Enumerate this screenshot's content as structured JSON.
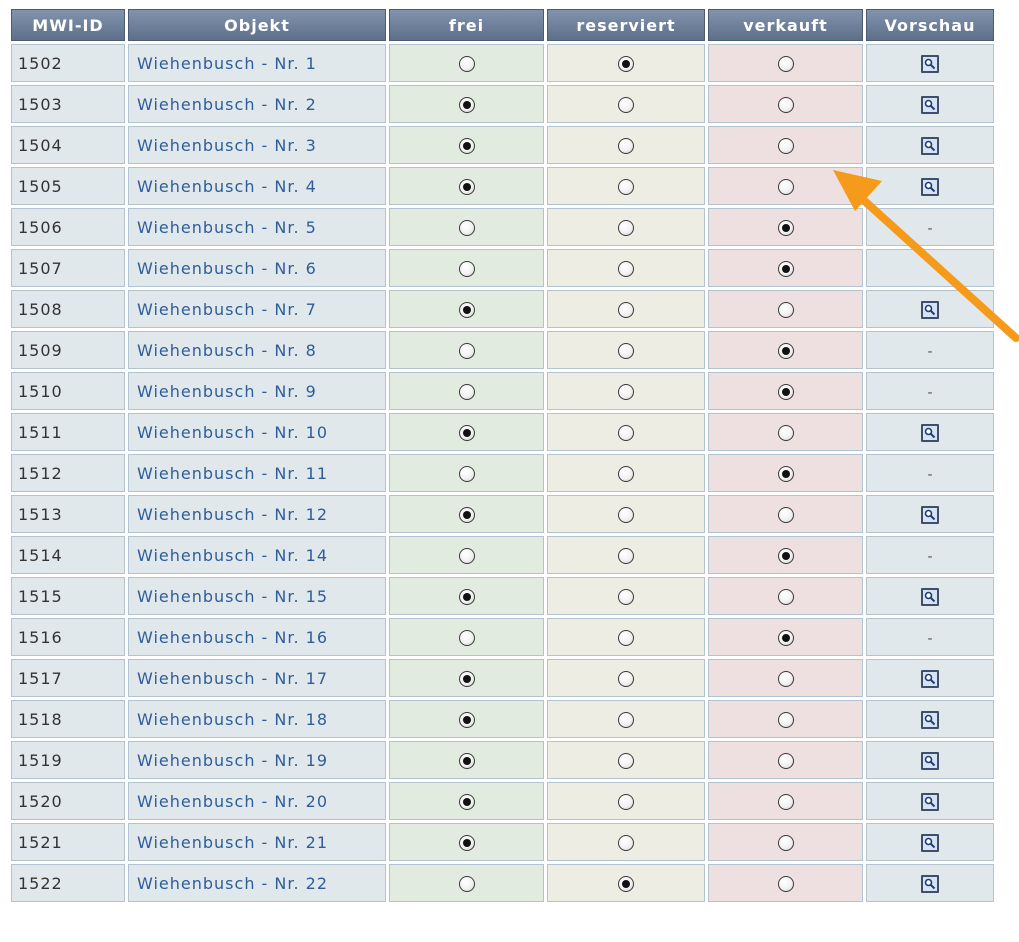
{
  "headers": {
    "id": "MWI-ID",
    "objekt": "Objekt",
    "frei": "frei",
    "reserviert": "reserviert",
    "verkauft": "verkauft",
    "vorschau": "Vorschau"
  },
  "preview_icon": "magnifier-icon",
  "no_preview_text": "-",
  "colors": {
    "header": "#6b7d97",
    "frei_bg": "#e1ebdf",
    "reserviert_bg": "#eeede3",
    "verkauft_bg": "#eedfe0",
    "link": "#2e5d99",
    "arrow": "#f59a1b"
  },
  "rows": [
    {
      "id": "1502",
      "objekt": "Wiehenbusch - Nr. 1",
      "status": "reserviert",
      "preview": true
    },
    {
      "id": "1503",
      "objekt": "Wiehenbusch - Nr. 2",
      "status": "frei",
      "preview": true
    },
    {
      "id": "1504",
      "objekt": "Wiehenbusch - Nr. 3",
      "status": "frei",
      "preview": true
    },
    {
      "id": "1505",
      "objekt": "Wiehenbusch - Nr. 4",
      "status": "frei",
      "preview": true
    },
    {
      "id": "1506",
      "objekt": "Wiehenbusch - Nr. 5",
      "status": "verkauft",
      "preview": false
    },
    {
      "id": "1507",
      "objekt": "Wiehenbusch - Nr. 6",
      "status": "verkauft",
      "preview": null
    },
    {
      "id": "1508",
      "objekt": "Wiehenbusch - Nr. 7",
      "status": "frei",
      "preview": true
    },
    {
      "id": "1509",
      "objekt": "Wiehenbusch - Nr. 8",
      "status": "verkauft",
      "preview": false
    },
    {
      "id": "1510",
      "objekt": "Wiehenbusch - Nr. 9",
      "status": "verkauft",
      "preview": false
    },
    {
      "id": "1511",
      "objekt": "Wiehenbusch - Nr. 10",
      "status": "frei",
      "preview": true
    },
    {
      "id": "1512",
      "objekt": "Wiehenbusch - Nr. 11",
      "status": "verkauft",
      "preview": false
    },
    {
      "id": "1513",
      "objekt": "Wiehenbusch - Nr. 12",
      "status": "frei",
      "preview": true
    },
    {
      "id": "1514",
      "objekt": "Wiehenbusch - Nr. 14",
      "status": "verkauft",
      "preview": false
    },
    {
      "id": "1515",
      "objekt": "Wiehenbusch - Nr. 15",
      "status": "frei",
      "preview": true
    },
    {
      "id": "1516",
      "objekt": "Wiehenbusch - Nr. 16",
      "status": "verkauft",
      "preview": false
    },
    {
      "id": "1517",
      "objekt": "Wiehenbusch - Nr. 17",
      "status": "frei",
      "preview": true
    },
    {
      "id": "1518",
      "objekt": "Wiehenbusch - Nr. 18",
      "status": "frei",
      "preview": true
    },
    {
      "id": "1519",
      "objekt": "Wiehenbusch - Nr. 19",
      "status": "frei",
      "preview": true
    },
    {
      "id": "1520",
      "objekt": "Wiehenbusch - Nr. 20",
      "status": "frei",
      "preview": true
    },
    {
      "id": "1521",
      "objekt": "Wiehenbusch - Nr. 21",
      "status": "frei",
      "preview": true
    },
    {
      "id": "1522",
      "objekt": "Wiehenbusch - Nr. 22",
      "status": "reserviert",
      "preview": true
    }
  ]
}
